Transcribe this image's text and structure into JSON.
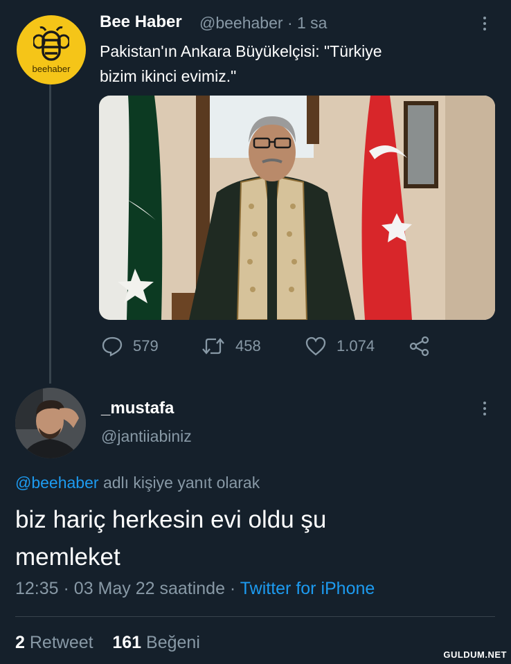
{
  "tweet": {
    "author_name": "Bee Haber",
    "author_handle": "@beehaber",
    "time_ago": "· 1 sa",
    "avatar_logo_text": "beehaber",
    "text_line1": "Pakistan'ın Ankara Büyükelçisi: \"Türkiye",
    "text_line2": "bizim ikinci evimiz.\"",
    "reply_count": "579",
    "retweet_count": "458",
    "like_count": "1.074"
  },
  "reply": {
    "author_name": "_mustafa",
    "author_handle": "@jantiiabiniz",
    "replying_to_handle": "@beehaber",
    "replying_to_suffix": " adlı kişiye yanıt olarak",
    "text_line1": "biz hariç herkesin evi oldu şu",
    "text_line2": "memleket",
    "time": "12:35",
    "date": "· 03 May 22 saatinde ·",
    "source": "Twitter for iPhone",
    "retweets_value": "2",
    "retweets_label": "Retweet",
    "likes_value": "161",
    "likes_label": "Beğeni"
  },
  "watermark": "GULDUM.NET",
  "colors": {
    "background": "#15202b",
    "muted": "#8899a6",
    "accent": "#1d9bf0",
    "avatar_bg": "#f5c518"
  },
  "icons": [
    "more-icon",
    "reply-icon",
    "retweet-icon",
    "like-icon",
    "share-icon",
    "bee-logo-icon"
  ]
}
